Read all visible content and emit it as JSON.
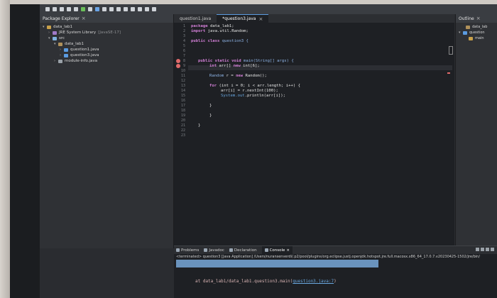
{
  "package_explorer": {
    "tab_label": "Package Explorer",
    "tree": [
      {
        "label": "data_lab1",
        "suffix": ""
      },
      {
        "label": "JRE System Library",
        "suffix": "[JavaSE-17]"
      },
      {
        "label": "src",
        "suffix": ""
      },
      {
        "label": "data_lab1",
        "suffix": ""
      },
      {
        "label": "question1.java",
        "suffix": ""
      },
      {
        "label": "question3.java",
        "suffix": ""
      },
      {
        "label": "module-info.java",
        "suffix": ""
      }
    ]
  },
  "editor": {
    "tabs": [
      {
        "label": "question1.java",
        "active": false
      },
      {
        "label": "*question3.java",
        "active": true
      }
    ],
    "line_numbers": [
      "1",
      "2",
      "3",
      "4",
      "5",
      "6",
      "7",
      "8",
      "9",
      "10",
      "11",
      "12",
      "13",
      "14",
      "15",
      "16",
      "17",
      "18",
      "19",
      "20",
      "21",
      "22",
      "23"
    ],
    "code": {
      "l1_kw": "package",
      "l1_rest": " data_lab1;",
      "l2_kw": "import",
      "l2_rest": " java.util.Random;",
      "l4_kw": "public class",
      "l4_rest": " question3 {",
      "l8_kw": "public static void",
      "l8_rest": " main(String[] args) {",
      "l9_a": "int",
      "l9_b": " arr[] ",
      "l9_c": "new",
      "l9_d": " int[6];",
      "l11_a": "Random",
      "l11_b": " r = ",
      "l11_c": "new",
      "l11_d": " Random();",
      "l13_a": "for",
      "l13_b": " (int i = 0; i < arr.length; i++) {",
      "l14": "arr[i] = r.nextInt(100);",
      "l15_a": "System.out",
      "l15_b": ".println(arr[i]);",
      "l17": "}",
      "l19": "}",
      "l21": "}"
    }
  },
  "outline": {
    "tab_label": "Outline",
    "items": [
      "data_lab",
      "question",
      "main"
    ]
  },
  "console": {
    "tabs": [
      "Problems",
      "Javadoc",
      "Declaration",
      "Console"
    ],
    "terminated": "<terminated> question3 [Java Application] /Users/nuransenverdi/.p2/pool/plugins/org.eclipse.justj.openjdk.hotspot.jre.full.macosx.x86_64_17.0.7.v20230425-1502/jre/bin/",
    "trace_prefix": "at data_lab1/data_lab1.question3.main(",
    "trace_link": "question3.java:7",
    "trace_suffix": ")"
  }
}
